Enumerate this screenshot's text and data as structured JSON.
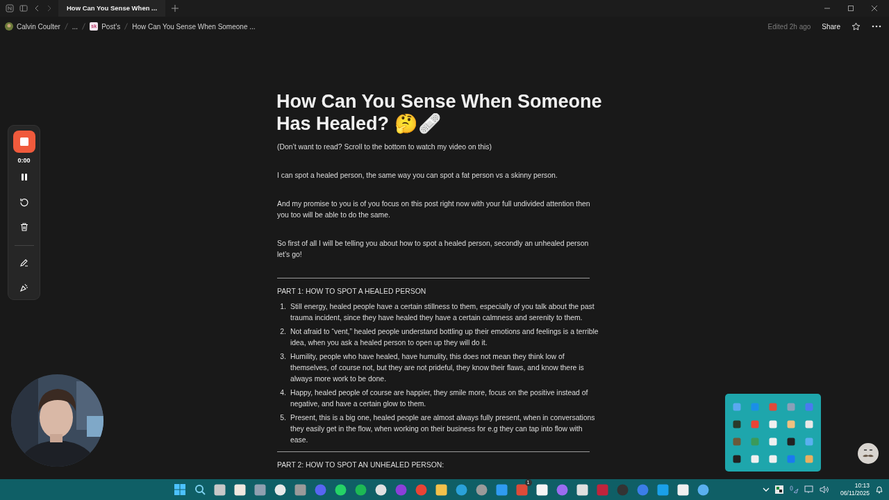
{
  "window": {
    "tabs": [
      {
        "label": "How Can You Sense When ...",
        "selected": true
      }
    ]
  },
  "breadcrumbs": [
    {
      "label": "Calvin Coulter",
      "kind": "avatar"
    },
    {
      "label": "...",
      "kind": "plain"
    },
    {
      "label": "Post’s",
      "kind": "logo",
      "logo_text": "sk"
    },
    {
      "label": "How Can You Sense When Someone ...",
      "kind": "plain"
    }
  ],
  "topbar": {
    "edited": "Edited 2h ago",
    "share": "Share",
    "favorite": false
  },
  "page": {
    "title": "How Can You Sense When Someone Has Healed? 🤔🩹",
    "blocks": [
      {
        "kind": "paragraph",
        "text": "(Don’t want to read? Scroll to the bottom to watch my video on this)"
      },
      {
        "kind": "paragraph",
        "text": "I can spot a healed person, the same way you can spot a fat person vs a skinny person."
      },
      {
        "kind": "paragraph",
        "text": "And my promise to you is of you focus on this post right now with your full undivided attention then you too will be able to do the same."
      },
      {
        "kind": "paragraph",
        "text": "So first of all I will be telling you about how to spot a healed person, secondly an unhealed person let’s go!"
      },
      {
        "kind": "divider"
      },
      {
        "kind": "heading",
        "text": "PART 1: HOW TO SPOT A HEALED PERSON"
      },
      {
        "kind": "list",
        "items": [
          {
            "num": "1.",
            "text": "Still energy, healed people have a certain stillness to them, especially of you talk about the past trauma incident, since they have healed they have a certain calmness and serenity to them."
          },
          {
            "num": "2.",
            "text": "Not afraid to “vent,” healed people understand bottling up their emotions and feelings is a terrible idea, when you ask a healed person to open up they will do it."
          },
          {
            "num": "3.",
            "text": "Humility, people who have healed, have humulity, this does not mean they think low of themselves, of course not, but they are not prideful, they know their flaws, and know there is always more work to be done."
          },
          {
            "num": "4.",
            "text": "Happy, healed people of course are happier, they smile more, focus on the positive instead of negative, and have a certain glow to them."
          },
          {
            "num": "5.",
            "text": "Present, this is a big one, healed people are almost always fully present, when in conversations they easily get in the flow, when working on their business for e.g they can tap into flow with ease."
          }
        ]
      },
      {
        "kind": "divider"
      },
      {
        "kind": "heading",
        "text": "PART 2: HOW TO SPOT AN UNHEALED PERSON:"
      }
    ]
  },
  "recorder": {
    "time": "0:00",
    "recording": true
  },
  "taskbar": {
    "badge": "1",
    "time": "10:13",
    "date": "06/11/2025"
  }
}
